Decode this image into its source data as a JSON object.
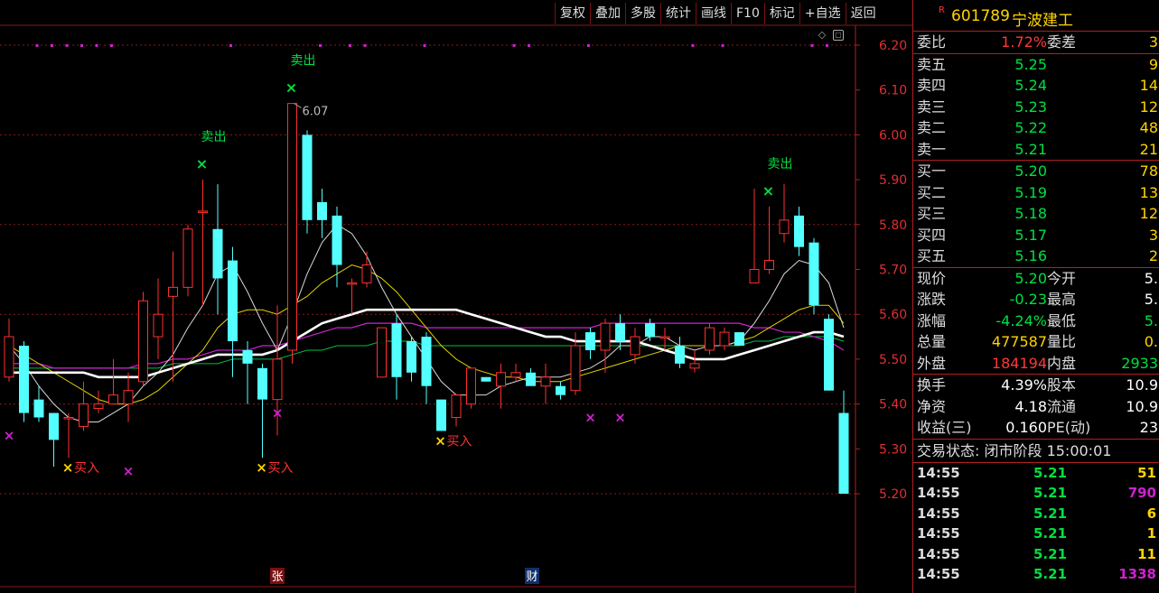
{
  "toolbar": [
    "复权",
    "叠加",
    "多股",
    "统计",
    "画线",
    "F10",
    "标记",
    "+自选",
    "返回"
  ],
  "chart_controls": {
    "diamond_icon": "◇",
    "box_icon": "▢"
  },
  "axis_labels": [
    "6.20",
    "6.10",
    "6.00",
    "5.90",
    "5.80",
    "5.70",
    "5.60",
    "5.50",
    "5.40",
    "5.30",
    "5.20"
  ],
  "annotations": {
    "sell_label": "卖出",
    "buy_label": "买入",
    "high_label": "6.07",
    "zhang_badge": "张",
    "cai_badge": "财"
  },
  "colors": {
    "up": "#ff3030",
    "down": "#54ffff",
    "buy_signal": "#ffd400",
    "sell_signal": "#00e040",
    "magenta": "#d020d0",
    "ma_white": "#ffffff",
    "ma_yellow": "#e6d200",
    "ma_green": "#00c040",
    "ma_magenta": "#d020d0"
  },
  "chart_data": {
    "type": "candlestick",
    "ylim": [
      5.19,
      6.23
    ],
    "candles": [
      {
        "o": 5.46,
        "h": 5.59,
        "l": 5.45,
        "c": 5.55
      },
      {
        "o": 5.53,
        "h": 5.54,
        "l": 5.36,
        "c": 5.38
      },
      {
        "o": 5.41,
        "h": 5.44,
        "l": 5.36,
        "c": 5.37
      },
      {
        "o": 5.38,
        "h": 5.38,
        "l": 5.26,
        "c": 5.32
      },
      {
        "o": 5.37,
        "h": 5.38,
        "l": 5.28,
        "c": 5.37
      },
      {
        "o": 5.35,
        "h": 5.45,
        "l": 5.34,
        "c": 5.4
      },
      {
        "o": 5.39,
        "h": 5.43,
        "l": 5.38,
        "c": 5.4
      },
      {
        "o": 5.4,
        "h": 5.5,
        "l": 5.4,
        "c": 5.42
      },
      {
        "o": 5.4,
        "h": 5.47,
        "l": 5.36,
        "c": 5.43
      },
      {
        "o": 5.45,
        "h": 5.65,
        "l": 5.44,
        "c": 5.63
      },
      {
        "o": 5.55,
        "h": 5.68,
        "l": 5.5,
        "c": 5.6
      },
      {
        "o": 5.64,
        "h": 5.74,
        "l": 5.45,
        "c": 5.66
      },
      {
        "o": 5.66,
        "h": 5.8,
        "l": 5.64,
        "c": 5.79
      },
      {
        "o": 5.83,
        "h": 5.9,
        "l": 5.62,
        "c": 5.83
      },
      {
        "o": 5.79,
        "h": 5.89,
        "l": 5.6,
        "c": 5.68
      },
      {
        "o": 5.72,
        "h": 5.75,
        "l": 5.46,
        "c": 5.54
      },
      {
        "o": 5.52,
        "h": 5.54,
        "l": 5.4,
        "c": 5.49
      },
      {
        "o": 5.48,
        "h": 5.49,
        "l": 5.28,
        "c": 5.41
      },
      {
        "o": 5.41,
        "h": 5.62,
        "l": 5.33,
        "c": 5.5
      },
      {
        "o": 5.52,
        "h": 6.07,
        "l": 5.49,
        "c": 6.07
      },
      {
        "o": 6.0,
        "h": 6.01,
        "l": 5.78,
        "c": 5.81
      },
      {
        "o": 5.85,
        "h": 5.88,
        "l": 5.77,
        "c": 5.81
      },
      {
        "o": 5.82,
        "h": 5.84,
        "l": 5.66,
        "c": 5.71
      },
      {
        "o": 5.67,
        "h": 5.68,
        "l": 5.6,
        "c": 5.67
      },
      {
        "o": 5.67,
        "h": 5.74,
        "l": 5.66,
        "c": 5.71
      },
      {
        "o": 5.46,
        "h": 5.57,
        "l": 5.46,
        "c": 5.57
      },
      {
        "o": 5.58,
        "h": 5.6,
        "l": 5.41,
        "c": 5.46
      },
      {
        "o": 5.54,
        "h": 5.55,
        "l": 5.45,
        "c": 5.47
      },
      {
        "o": 5.55,
        "h": 5.56,
        "l": 5.4,
        "c": 5.44
      },
      {
        "o": 5.41,
        "h": 5.41,
        "l": 5.34,
        "c": 5.34
      },
      {
        "o": 5.37,
        "h": 5.42,
        "l": 5.35,
        "c": 5.42
      },
      {
        "o": 5.4,
        "h": 5.48,
        "l": 5.39,
        "c": 5.48
      },
      {
        "o": 5.46,
        "h": 5.46,
        "l": 5.45,
        "c": 5.45
      },
      {
        "o": 5.44,
        "h": 5.49,
        "l": 5.39,
        "c": 5.47
      },
      {
        "o": 5.46,
        "h": 5.49,
        "l": 5.45,
        "c": 5.47
      },
      {
        "o": 5.47,
        "h": 5.48,
        "l": 5.45,
        "c": 5.44
      },
      {
        "o": 5.44,
        "h": 5.49,
        "l": 5.4,
        "c": 5.46
      },
      {
        "o": 5.44,
        "h": 5.45,
        "l": 5.41,
        "c": 5.42
      },
      {
        "o": 5.43,
        "h": 5.56,
        "l": 5.42,
        "c": 5.53
      },
      {
        "o": 5.56,
        "h": 5.57,
        "l": 5.5,
        "c": 5.52
      },
      {
        "o": 5.52,
        "h": 5.59,
        "l": 5.47,
        "c": 5.58
      },
      {
        "o": 5.58,
        "h": 5.6,
        "l": 5.52,
        "c": 5.54
      },
      {
        "o": 5.51,
        "h": 5.57,
        "l": 5.49,
        "c": 5.55
      },
      {
        "o": 5.58,
        "h": 5.59,
        "l": 5.54,
        "c": 5.55
      },
      {
        "o": 5.55,
        "h": 5.57,
        "l": 5.52,
        "c": 5.55
      },
      {
        "o": 5.53,
        "h": 5.55,
        "l": 5.48,
        "c": 5.49
      },
      {
        "o": 5.48,
        "h": 5.52,
        "l": 5.47,
        "c": 5.49
      },
      {
        "o": 5.52,
        "h": 5.58,
        "l": 5.51,
        "c": 5.57
      },
      {
        "o": 5.53,
        "h": 5.57,
        "l": 5.52,
        "c": 5.56
      },
      {
        "o": 5.56,
        "h": 5.56,
        "l": 5.53,
        "c": 5.53
      },
      {
        "o": 5.67,
        "h": 5.88,
        "l": 5.67,
        "c": 5.7
      },
      {
        "o": 5.7,
        "h": 5.84,
        "l": 5.69,
        "c": 5.72
      },
      {
        "o": 5.78,
        "h": 5.89,
        "l": 5.76,
        "c": 5.81
      },
      {
        "o": 5.82,
        "h": 5.84,
        "l": 5.73,
        "c": 5.75
      },
      {
        "o": 5.76,
        "h": 5.77,
        "l": 5.6,
        "c": 5.62
      },
      {
        "o": 5.59,
        "h": 5.6,
        "l": 5.43,
        "c": 5.43
      },
      {
        "o": 5.38,
        "h": 5.43,
        "l": 5.2,
        "c": 5.2
      }
    ],
    "ma_short": [
      5.53,
      5.49,
      5.44,
      5.4,
      5.37,
      5.36,
      5.36,
      5.38,
      5.4,
      5.44,
      5.47,
      5.51,
      5.57,
      5.62,
      5.69,
      5.71,
      5.65,
      5.58,
      5.52,
      5.6,
      5.69,
      5.76,
      5.8,
      5.78,
      5.73,
      5.66,
      5.6,
      5.55,
      5.5,
      5.45,
      5.42,
      5.42,
      5.42,
      5.44,
      5.45,
      5.46,
      5.46,
      5.46,
      5.47,
      5.48,
      5.5,
      5.53,
      5.53,
      5.55,
      5.55,
      5.53,
      5.52,
      5.53,
      5.53,
      5.54,
      5.58,
      5.63,
      5.69,
      5.72,
      5.71,
      5.67,
      5.57
    ],
    "ma_mid": [
      5.53,
      5.51,
      5.49,
      5.47,
      5.45,
      5.43,
      5.41,
      5.4,
      5.4,
      5.41,
      5.43,
      5.46,
      5.49,
      5.52,
      5.57,
      5.6,
      5.61,
      5.61,
      5.6,
      5.62,
      5.64,
      5.67,
      5.69,
      5.71,
      5.7,
      5.68,
      5.65,
      5.61,
      5.57,
      5.53,
      5.5,
      5.48,
      5.47,
      5.46,
      5.46,
      5.45,
      5.45,
      5.45,
      5.46,
      5.47,
      5.48,
      5.49,
      5.5,
      5.51,
      5.52,
      5.53,
      5.53,
      5.53,
      5.53,
      5.54,
      5.55,
      5.57,
      5.59,
      5.61,
      5.62,
      5.62,
      5.58
    ],
    "ma_long": [
      5.47,
      5.47,
      5.47,
      5.47,
      5.47,
      5.47,
      5.46,
      5.46,
      5.46,
      5.46,
      5.47,
      5.48,
      5.49,
      5.5,
      5.51,
      5.51,
      5.51,
      5.51,
      5.52,
      5.54,
      5.56,
      5.58,
      5.59,
      5.6,
      5.61,
      5.61,
      5.61,
      5.61,
      5.61,
      5.61,
      5.61,
      5.6,
      5.59,
      5.58,
      5.57,
      5.56,
      5.55,
      5.55,
      5.54,
      5.54,
      5.54,
      5.54,
      5.54,
      5.53,
      5.52,
      5.51,
      5.5,
      5.5,
      5.5,
      5.51,
      5.52,
      5.53,
      5.54,
      5.55,
      5.56,
      5.56,
      5.55
    ],
    "ma_purple": [
      5.49,
      5.49,
      5.49,
      5.48,
      5.48,
      5.48,
      5.48,
      5.48,
      5.48,
      5.49,
      5.49,
      5.5,
      5.5,
      5.51,
      5.52,
      5.52,
      5.52,
      5.53,
      5.53,
      5.54,
      5.55,
      5.56,
      5.57,
      5.57,
      5.58,
      5.58,
      5.58,
      5.58,
      5.57,
      5.57,
      5.57,
      5.57,
      5.57,
      5.57,
      5.57,
      5.57,
      5.57,
      5.57,
      5.57,
      5.57,
      5.58,
      5.58,
      5.58,
      5.58,
      5.58,
      5.58,
      5.58,
      5.58,
      5.58,
      5.58,
      5.57,
      5.57,
      5.56,
      5.56,
      5.55,
      5.54,
      5.52
    ],
    "ma_green": [
      5.48,
      5.48,
      5.48,
      5.48,
      5.48,
      5.48,
      5.48,
      5.48,
      5.48,
      5.48,
      5.48,
      5.49,
      5.49,
      5.49,
      5.49,
      5.5,
      5.5,
      5.5,
      5.5,
      5.51,
      5.52,
      5.52,
      5.53,
      5.53,
      5.53,
      5.54,
      5.54,
      5.54,
      5.53,
      5.53,
      5.53,
      5.53,
      5.53,
      5.53,
      5.53,
      5.53,
      5.53,
      5.53,
      5.53,
      5.53,
      5.53,
      5.53,
      5.53,
      5.53,
      5.53,
      5.53,
      5.53,
      5.53,
      5.53,
      5.53,
      5.54,
      5.54,
      5.55,
      5.55,
      5.55,
      5.55,
      5.54
    ],
    "sell_signals": [
      13,
      19,
      51
    ],
    "buy_signals": [
      4,
      17,
      29
    ],
    "magenta_markers": [
      {
        "i": 0,
        "y": 5.33
      },
      {
        "i": 8,
        "y": 5.25
      },
      {
        "i": 18,
        "y": 5.38
      },
      {
        "i": 39,
        "y": 5.37
      },
      {
        "i": 41,
        "y": 5.37
      }
    ],
    "top_dot_indices": [
      1,
      2,
      3,
      4,
      5,
      6,
      14,
      20,
      22,
      23,
      27,
      33,
      34,
      38,
      45,
      47,
      53,
      54
    ]
  },
  "quote": {
    "r_mark": "R",
    "code": "601789",
    "name": "宁波建工",
    "weibi": {
      "label": "委比",
      "value": "1.72%",
      "label2": "委差",
      "value2": "3"
    },
    "sells": [
      {
        "label": "卖五",
        "price": "5.25",
        "vol": "9"
      },
      {
        "label": "卖四",
        "price": "5.24",
        "vol": "14"
      },
      {
        "label": "卖三",
        "price": "5.23",
        "vol": "12"
      },
      {
        "label": "卖二",
        "price": "5.22",
        "vol": "48"
      },
      {
        "label": "卖一",
        "price": "5.21",
        "vol": "21"
      }
    ],
    "buys": [
      {
        "label": "买一",
        "price": "5.20",
        "vol": "78"
      },
      {
        "label": "买二",
        "price": "5.19",
        "vol": "13"
      },
      {
        "label": "买三",
        "price": "5.18",
        "vol": "12"
      },
      {
        "label": "买四",
        "price": "5.17",
        "vol": "3"
      },
      {
        "label": "买五",
        "price": "5.16",
        "vol": "2"
      }
    ],
    "stats1": [
      {
        "a": "现价",
        "b": "5.20",
        "bc": "green",
        "c": "今开",
        "d": "5.",
        "dc": "white"
      },
      {
        "a": "涨跌",
        "b": "-0.23",
        "bc": "green",
        "c": "最高",
        "d": "5.",
        "dc": "white"
      },
      {
        "a": "涨幅",
        "b": "-4.24%",
        "bc": "green",
        "c": "最低",
        "d": "5.",
        "dc": "green"
      },
      {
        "a": "总量",
        "b": "477587",
        "bc": "yellow",
        "c": "量比",
        "d": "0.",
        "dc": "yellow"
      },
      {
        "a": "外盘",
        "b": "184194",
        "bc": "red",
        "c": "内盘",
        "d": "2933",
        "dc": "green"
      }
    ],
    "stats2": [
      {
        "a": "换手",
        "b": "4.39%",
        "bc": "white",
        "c": "股本",
        "d": "10.9",
        "dc": "white"
      },
      {
        "a": "净资",
        "b": "4.18",
        "bc": "white",
        "c": "流通",
        "d": "10.9",
        "dc": "white"
      },
      {
        "a": "收益(三)",
        "b": "0.160",
        "bc": "white",
        "c": "PE(动)",
        "d": "23",
        "dc": "white"
      }
    ],
    "status": "交易状态: 闭市阶段 15:00:01",
    "ticks": [
      {
        "t": "14:55",
        "p": "5.21",
        "v": "51",
        "vc": "yellow"
      },
      {
        "t": "14:55",
        "p": "5.21",
        "v": "790",
        "vc": "magenta"
      },
      {
        "t": "14:55",
        "p": "5.21",
        "v": "6",
        "vc": "yellow"
      },
      {
        "t": "14:55",
        "p": "5.21",
        "v": "1",
        "vc": "yellow"
      },
      {
        "t": "14:55",
        "p": "5.21",
        "v": "11",
        "vc": "yellow"
      },
      {
        "t": "14:55",
        "p": "5.21",
        "v": "1338",
        "vc": "magenta"
      }
    ]
  }
}
